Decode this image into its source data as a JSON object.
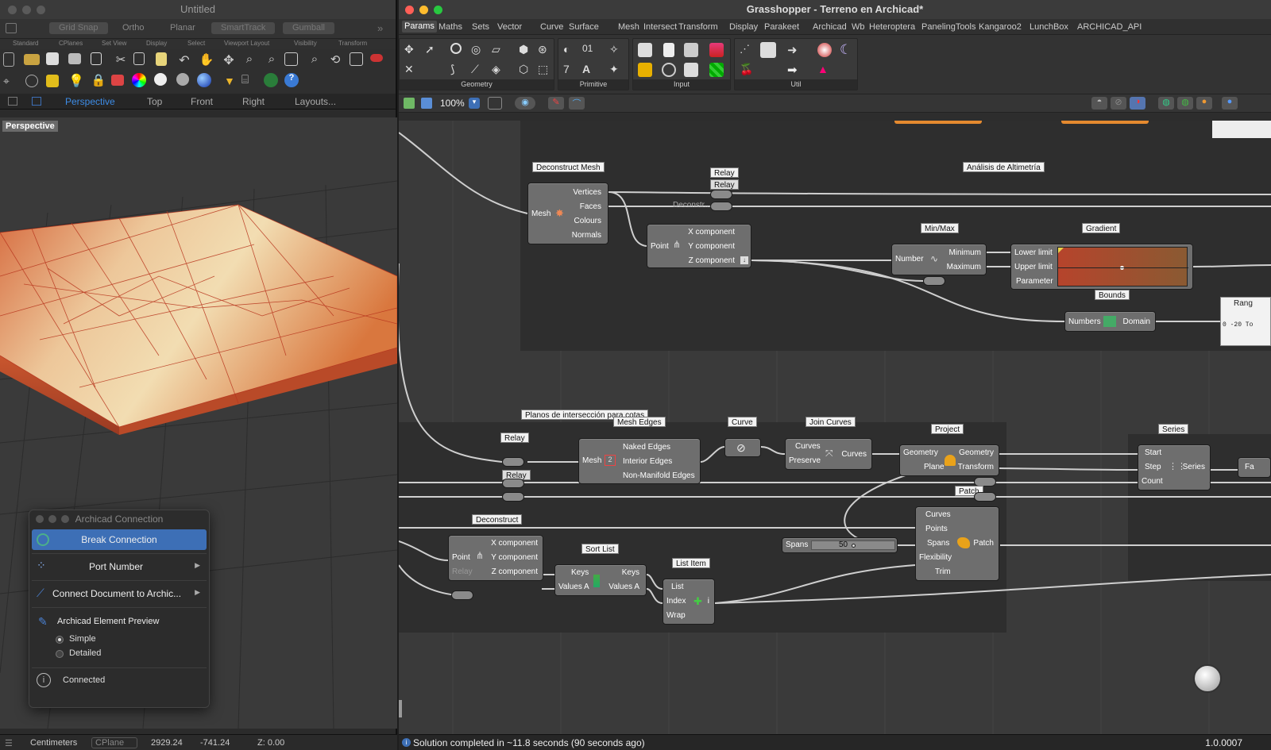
{
  "rhino": {
    "window_title": "Untitled",
    "osnap": [
      "Grid Snap",
      "Ortho",
      "Planar",
      "SmartTrack",
      "Gumball"
    ],
    "toolbar_tabs": [
      "Standard",
      "CPlanes",
      "Set View",
      "Display",
      "Select",
      "Viewport Layout",
      "Visibility",
      "Transform"
    ],
    "view_tabs": [
      "Perspective",
      "Top",
      "Front",
      "Right",
      "Layouts..."
    ],
    "active_view": "Perspective",
    "viewport_label": "Perspective",
    "status": {
      "units": "Centimeters",
      "cplane": "CPlane",
      "x": "2929.24",
      "y": "-741.24",
      "z": "Z: 0.00"
    }
  },
  "archicad_panel": {
    "title": "Archicad Connection",
    "break_label": "Break Connection",
    "port_label": "Port Number",
    "connect_label": "Connect Document to Archic...",
    "preview_label": "Archicad Element Preview",
    "option_simple": "Simple",
    "option_detailed": "Detailed",
    "status_label": "Connected"
  },
  "grasshopper": {
    "window_title": "Grasshopper - Terreno en Archicad*",
    "menu": [
      "Params",
      "Maths",
      "Sets",
      "Vector",
      "Curve",
      "Surface",
      "Mesh",
      "Intersect",
      "Transform",
      "Display",
      "Parakeet",
      "Archicad",
      "Wb",
      "Heteroptera",
      "PanelingTools",
      "Kangaroo2",
      "LunchBox",
      "ARCHICAD_API"
    ],
    "ribbon_groups": [
      "Geometry",
      "Primitive",
      "Input",
      "Util"
    ],
    "zoom": "100%",
    "status_text": "Solution completed in ~11.8 seconds (90 seconds ago)",
    "version": "1.0.0007",
    "groups": {
      "altimetria": "Análisis de Altimetría",
      "planos": "Planos de intersección para cotas"
    },
    "components": {
      "deconstruct_mesh": {
        "title": "Deconstruct Mesh",
        "input": "Mesh",
        "outputs": [
          "Vertices",
          "Faces",
          "Colours",
          "Normals"
        ]
      },
      "relay_top": {
        "title": "Relay",
        "sub": "Relay"
      },
      "deconstruct_label": "Deconstr...",
      "deconstruct_point_top": {
        "input": "Point",
        "outputs": [
          "X component",
          "Y component",
          "Z component"
        ]
      },
      "minmax": {
        "title": "Min/Max",
        "input": "Number",
        "outputs": [
          "Minimum",
          "Maximum"
        ]
      },
      "gradient": {
        "title": "Gradient",
        "inputs": [
          "Lower limit",
          "Upper limit",
          "Parameter"
        ]
      },
      "bounds": {
        "title": "Bounds",
        "input": "Numbers",
        "output": "Domain"
      },
      "range_label": "Rang",
      "range_text": "0 -20 To",
      "relay_mid": {
        "title": "Relay",
        "sub": "Relay"
      },
      "mesh_edges": {
        "title": "Mesh Edges",
        "input": "Mesh",
        "outputs": [
          "Naked Edges",
          "Interior Edges",
          "Non-Manifold Edges"
        ]
      },
      "curve": {
        "title": "Curve"
      },
      "join_curves": {
        "title": "Join Curves",
        "inputs": [
          "Curves",
          "Preserve"
        ],
        "output": "Curves"
      },
      "project": {
        "title": "Project",
        "inputs": [
          "Geometry",
          "Plane"
        ],
        "outputs": [
          "Geometry",
          "Transform"
        ]
      },
      "series": {
        "title": "Series",
        "inputs": [
          "Start",
          "Step",
          "Count"
        ],
        "output": "Series"
      },
      "series_next": "Fa",
      "deconstruct_bottom": {
        "title": "Deconstruct",
        "input": "Point",
        "outputs": [
          "X component",
          "Y component",
          "Z component"
        ],
        "ghost": "Relay"
      },
      "sort_list": {
        "title": "Sort List",
        "inputs": [
          "Keys",
          "Values A"
        ],
        "outputs": [
          "Keys",
          "Values A"
        ]
      },
      "list_item": {
        "title": "List Item",
        "inputs": [
          "List",
          "Index",
          "Wrap"
        ],
        "output": "i"
      },
      "patch": {
        "title": "Patch",
        "inputs": [
          "Curves",
          "Points",
          "Spans",
          "Flexibility",
          "Trim"
        ],
        "output": "Patch"
      },
      "spans_slider": {
        "label": "Spans",
        "value": "50"
      }
    }
  },
  "colors": {
    "accent": "#3d6fb6",
    "terrain": "#d98050",
    "gradient_low": "#b6442c",
    "gradient_high": "#8a5a32",
    "canvas": "#3a3a3a"
  }
}
